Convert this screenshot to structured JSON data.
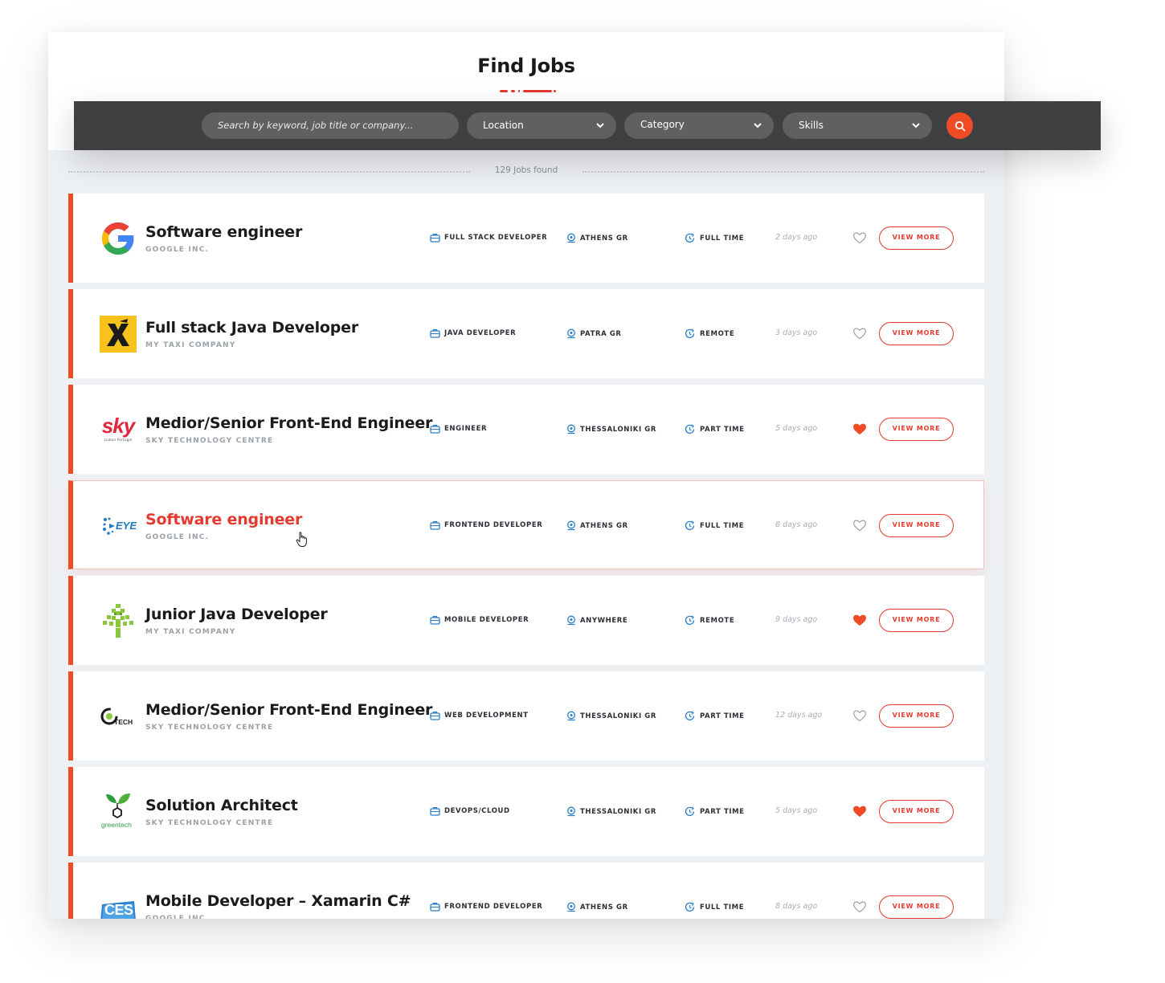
{
  "page": {
    "title": "Find Jobs"
  },
  "search": {
    "keyword_placeholder": "Search by keyword, job title or company...",
    "location_label": "Location",
    "category_label": "Category",
    "skills_label": "Skills",
    "search_icon": "search-icon"
  },
  "results": {
    "count_text": "129 Jobs found"
  },
  "colors": {
    "accent": "#ef4b24",
    "bar": "#3f4042",
    "pill": "#5f6062"
  },
  "jobs": [
    {
      "title": "Software engineer",
      "company": "GOOGLE INC.",
      "category": "FULL STACK DEVELOPER",
      "location": "ATHENS GR",
      "type": "FULL TIME",
      "posted": "2 days ago",
      "favorite": false,
      "action": "VIEW MORE",
      "logo": "google-logo"
    },
    {
      "title": "Full stack Java Developer",
      "company": "MY TAXI COMPANY",
      "category": "JAVA DEVELOPER",
      "location": "PATRA GR",
      "type": "REMOTE",
      "posted": "3 days ago",
      "favorite": false,
      "action": "VIEW MORE",
      "logo": "taxi-logo"
    },
    {
      "title": "Medior/Senior Front-End Engineer",
      "company": "SKY TECHNOLOGY CENTRE",
      "category": "ENGINEER",
      "location": "THESSALONIKI GR",
      "type": "PART TIME",
      "posted": "5 days ago",
      "favorite": true,
      "action": "VIEW MORE",
      "logo": "sky-logo",
      "logo_text": "sky",
      "logo_subtext": "Lisbon Portugal"
    },
    {
      "title": "Software engineer",
      "company": "GOOGLE INC.",
      "category": "FRONTEND DEVELOPER",
      "location": "ATHENS GR",
      "type": "FULL TIME",
      "posted": "8 days ago",
      "favorite": false,
      "action": "VIEW MORE",
      "logo": "eye-logo",
      "logo_text": "EYE",
      "highlighted": true
    },
    {
      "title": "Junior Java Developer",
      "company": "MY TAXI COMPANY",
      "category": "MOBILE DEVELOPER",
      "location": "ANYWHERE",
      "type": "REMOTE",
      "posted": "9 days ago",
      "favorite": true,
      "action": "VIEW MORE",
      "logo": "tree-logo"
    },
    {
      "title": "Medior/Senior Front-End Engineer",
      "company": "SKY TECHNOLOGY CENTRE",
      "category": "WEB DEVELOPMENT",
      "location": "THESSALONIKI GR",
      "type": "PART TIME",
      "posted": "12 days ago",
      "favorite": false,
      "action": "VIEW MORE",
      "logo": "tech-logo",
      "logo_text": "TECH"
    },
    {
      "title": "Solution Architect",
      "company": "SKY TECHNOLOGY CENTRE",
      "category": "DEVOPS/CLOUD",
      "location": "THESSALONIKI GR",
      "type": "PART TIME",
      "posted": "5 days ago",
      "favorite": true,
      "action": "VIEW MORE",
      "logo": "greentech-logo",
      "logo_text": "greentech"
    },
    {
      "title": "Mobile Developer – Xamarin C#",
      "company": "GOOGLE INC.",
      "category": "FRONTEND DEVELOPER",
      "location": "ATHENS GR",
      "type": "FULL TIME",
      "posted": "8 days ago",
      "favorite": false,
      "action": "VIEW MORE",
      "logo": "ces-logo",
      "logo_text": "CES"
    }
  ]
}
